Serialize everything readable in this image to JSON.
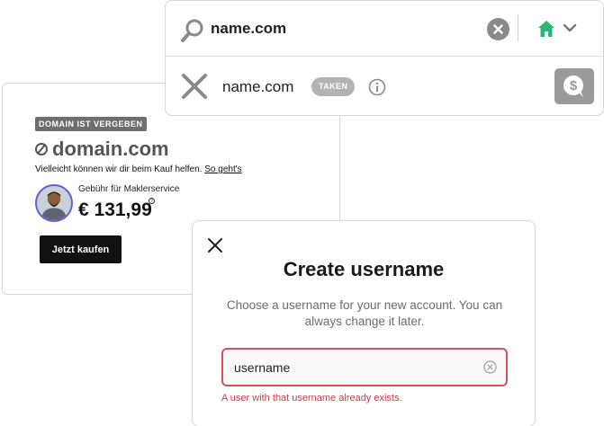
{
  "domain_card": {
    "badge": "DOMAIN IST VERGEBEN",
    "domain": "domain.com",
    "help_text": "Vielleicht können wir dir beim Kauf helfen.",
    "help_link": "So geht's",
    "broker_label": "Gebühr für Maklerservice",
    "price": "€ 131,99",
    "price_info": "?",
    "buy_label": "Jetzt kaufen"
  },
  "search": {
    "query": "name.com",
    "result_domain": "name.com",
    "result_status": "TAKEN",
    "icons": {
      "search": "magnifier-icon",
      "clear": "clear-icon",
      "home": "home-icon",
      "chevron": "chevron-down-icon",
      "taken": "x-icon",
      "info": "info-icon",
      "offer": "dollar-chat-icon"
    }
  },
  "modal": {
    "title": "Create username",
    "subtitle": "Choose a username for your new account. You can always change it later.",
    "username_value": "username",
    "error": "A user with that username already exists."
  },
  "colors": {
    "accent_green": "#2bb673",
    "error_red": "#d94f5c",
    "dark": "#111111",
    "badge_gray": "#6e6e6e"
  }
}
